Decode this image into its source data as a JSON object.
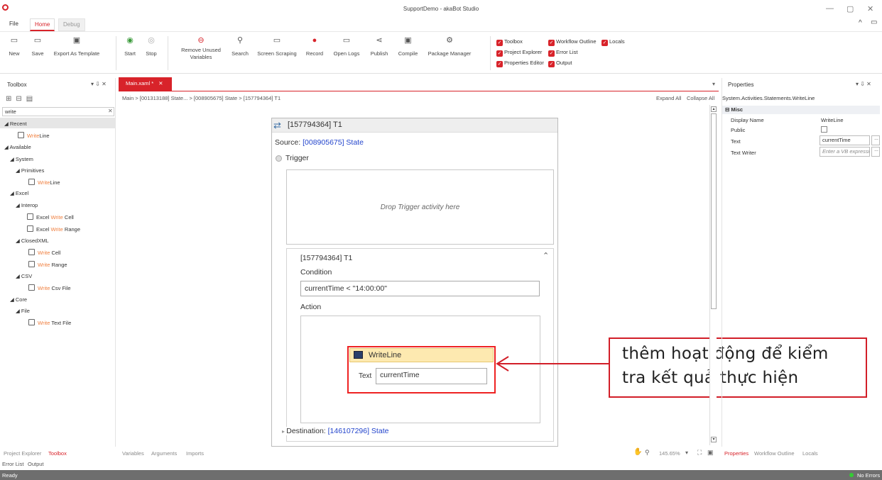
{
  "window": {
    "title": "SupportDemo - akaBot Studio",
    "minimize": "—",
    "restore": "▢",
    "close": "✕"
  },
  "menu": {
    "tabs": [
      {
        "label": "File"
      },
      {
        "label": "Home"
      },
      {
        "label": "Debug"
      }
    ]
  },
  "ribbon": {
    "buttons": [
      {
        "label": "New",
        "icon": "new-icon"
      },
      {
        "label": "Save",
        "icon": "save-icon"
      },
      {
        "label": "Export As Template",
        "icon": "export-template-icon"
      },
      {
        "label": "Start",
        "icon": "play-icon"
      },
      {
        "label": "Stop",
        "icon": "stop-icon"
      },
      {
        "label": "Remove Unused Variables",
        "icon": "remove-variables-icon"
      },
      {
        "label": "Search",
        "icon": "search-icon"
      },
      {
        "label": "Screen Scraping",
        "icon": "screen-scraping-icon"
      },
      {
        "label": "Record",
        "icon": "record-icon"
      },
      {
        "label": "Open Logs",
        "icon": "open-logs-icon"
      },
      {
        "label": "Publish",
        "icon": "publish-icon"
      },
      {
        "label": "Compile",
        "icon": "compile-icon"
      },
      {
        "label": "Package Manager",
        "icon": "package-manager-icon"
      }
    ],
    "panel_toggles": [
      {
        "label": "Toolbox",
        "checked": true
      },
      {
        "label": "Workflow Outline",
        "checked": true
      },
      {
        "label": "Locals",
        "checked": true
      },
      {
        "label": "Project Explorer",
        "checked": true
      },
      {
        "label": "Error List",
        "checked": true
      },
      {
        "label": "Properties Editor",
        "checked": true
      },
      {
        "label": "Output",
        "checked": true
      }
    ]
  },
  "toolbox": {
    "title": "Toolbox",
    "search_value": "write",
    "tree": [
      {
        "text": "◢ Recent",
        "hl": ""
      },
      {
        "text": "",
        "hl": "Write",
        "rest": "Line"
      },
      {
        "text": "◢ Available",
        "hl": ""
      },
      {
        "text": "◢ System",
        "hl": ""
      },
      {
        "text": "◢ Primitives",
        "hl": ""
      },
      {
        "text": "",
        "hl": "Write",
        "rest": "Line"
      },
      {
        "text": "◢ Excel",
        "hl": ""
      },
      {
        "text": "◢ Interop",
        "hl": ""
      },
      {
        "text": "Excel ",
        "hl": "Write",
        "rest": " Cell"
      },
      {
        "text": "Excel ",
        "hl": "Write",
        "rest": " Range"
      },
      {
        "text": "◢ ClosedXML",
        "hl": ""
      },
      {
        "text": "",
        "hl": "Write",
        "rest": " Cell"
      },
      {
        "text": "",
        "hl": "Write",
        "rest": " Range"
      },
      {
        "text": "◢ CSV",
        "hl": ""
      },
      {
        "text": "",
        "hl": "Write",
        "rest": " Csv File"
      },
      {
        "text": "◢ Core",
        "hl": ""
      },
      {
        "text": "◢ File",
        "hl": ""
      },
      {
        "text": "",
        "hl": "Write",
        "rest": " Text File"
      }
    ]
  },
  "designer": {
    "tab_label": "Main.xaml *",
    "breadcrumb": "Main  >  [001313188] State...  >  [008905675] State  >  [157794364] T1",
    "expand_all": "Expand All",
    "collapse_all": "Collapse All",
    "state_header": "[157794364] T1",
    "source_label": "Source:",
    "source_value": "[008905675] State",
    "trigger_label": "Trigger",
    "drop_trigger": "Drop Trigger activity here",
    "transition_title": "[157794364] T1",
    "condition_label": "Condition",
    "condition_value": "currentTime < \"14:00:00\"",
    "action_label": "Action",
    "writeline_title": "WriteLine",
    "writeline_text_label": "Text",
    "writeline_text_value": "currentTime",
    "destination_label": "Destination:",
    "destination_value": "[146107296] State",
    "zoom": "145.65%"
  },
  "annotation": {
    "line1": "thêm hoạt động để kiểm",
    "line2": "tra kết quả thực hiện"
  },
  "properties": {
    "title": "Properties",
    "type": "System.Activities.Statements.WriteLine",
    "section": "Misc",
    "rows": [
      {
        "name": "Display Name",
        "value": "WriteLine"
      },
      {
        "name": "Public",
        "value": ""
      },
      {
        "name": "Text",
        "value": "currentTime"
      },
      {
        "name": "Text Writer",
        "value": "Enter a VB expressi"
      }
    ]
  },
  "bottom": {
    "left_tabs": [
      "Project Explorer",
      "Toolbox"
    ],
    "left_tabs2": [
      "Error List",
      "Output"
    ],
    "designer_tabs": [
      "Variables",
      "Arguments",
      "Imports"
    ],
    "right_tabs": [
      "Properties",
      "Workflow Outline",
      "Locals"
    ]
  },
  "status": {
    "left": "Ready",
    "right": "No Errors"
  },
  "colors": {
    "accent": "#d8232a",
    "highlight": "#f08040",
    "status_bar": "#6e6e6e",
    "writeline_header": "#fde9b0"
  }
}
